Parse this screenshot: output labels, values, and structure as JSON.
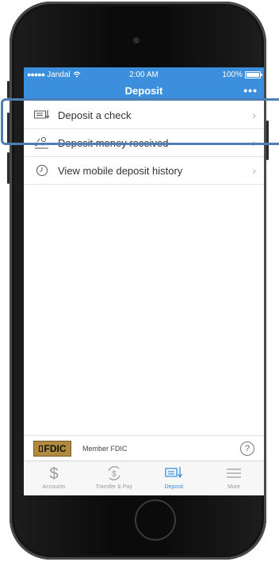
{
  "status_bar": {
    "carrier": "Jandal",
    "time": "2:00 AM",
    "battery": "100%"
  },
  "nav": {
    "title": "Deposit",
    "more_label": "•••"
  },
  "menu": {
    "items": [
      {
        "label": "Deposit a check",
        "icon": "check-icon"
      },
      {
        "label": "Deposit money received",
        "icon": "hand-money-icon"
      },
      {
        "label": "View mobile deposit history",
        "icon": "clock-icon"
      }
    ],
    "chevron": "›"
  },
  "fdic": {
    "logo_text": "FDIC",
    "member_text": "Member FDIC",
    "help_label": "?"
  },
  "tabs": [
    {
      "label": "Accounts",
      "icon": "dollar-icon",
      "active": false
    },
    {
      "label": "Transfer & Pay",
      "icon": "transfer-icon",
      "active": false
    },
    {
      "label": "Deposit",
      "icon": "deposit-icon",
      "active": true
    },
    {
      "label": "More",
      "icon": "menu-icon",
      "active": false
    }
  ],
  "colors": {
    "brand_blue": "#3b8fdc",
    "highlight": "#4e7fb5",
    "fdic_gold": "#b08a3e"
  }
}
